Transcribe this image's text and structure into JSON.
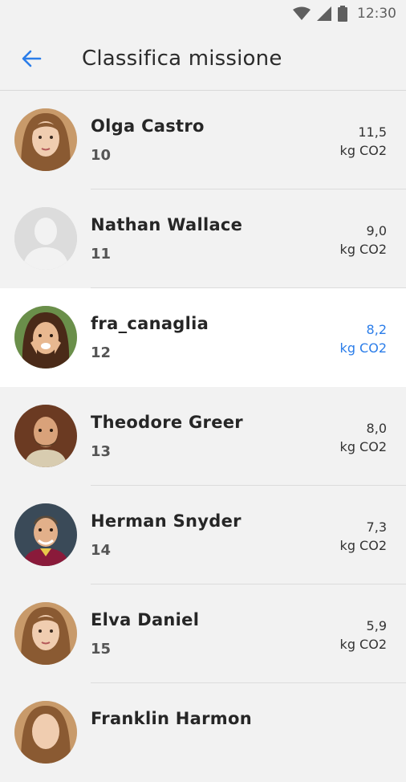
{
  "status": {
    "time": "12:30"
  },
  "header": {
    "title": "Classifica missione"
  },
  "colors": {
    "accent": "#2b7de9",
    "highlight_bg": "#ffffff",
    "background": "#f2f2f2"
  },
  "ranking": [
    {
      "name": "Olga Castro",
      "rank": "10",
      "value": "11,5",
      "unit": "kg CO2",
      "avatar": "photo-woman-blonde",
      "highlight": false
    },
    {
      "name": "Nathan Wallace",
      "rank": "11",
      "value": "9,0",
      "unit": "kg CO2",
      "avatar": "placeholder-person",
      "highlight": false
    },
    {
      "name": "fra_canaglia",
      "rank": "12",
      "value": "8,2",
      "unit": "kg CO2",
      "avatar": "photo-woman-brunette",
      "highlight": true
    },
    {
      "name": "Theodore Greer",
      "rank": "13",
      "value": "8,0",
      "unit": "kg CO2",
      "avatar": "photo-man-bearded",
      "highlight": false
    },
    {
      "name": "Herman Snyder",
      "rank": "14",
      "value": "7,3",
      "unit": "kg CO2",
      "avatar": "photo-man-smiling",
      "highlight": false
    },
    {
      "name": "Elva Daniel",
      "rank": "15",
      "value": "5,9",
      "unit": "kg CO2",
      "avatar": "photo-woman-blonde",
      "highlight": false
    },
    {
      "name": "Franklin Harmon",
      "rank": "",
      "value": "",
      "unit": "",
      "avatar": "photo-woman-blonde",
      "highlight": false
    }
  ]
}
